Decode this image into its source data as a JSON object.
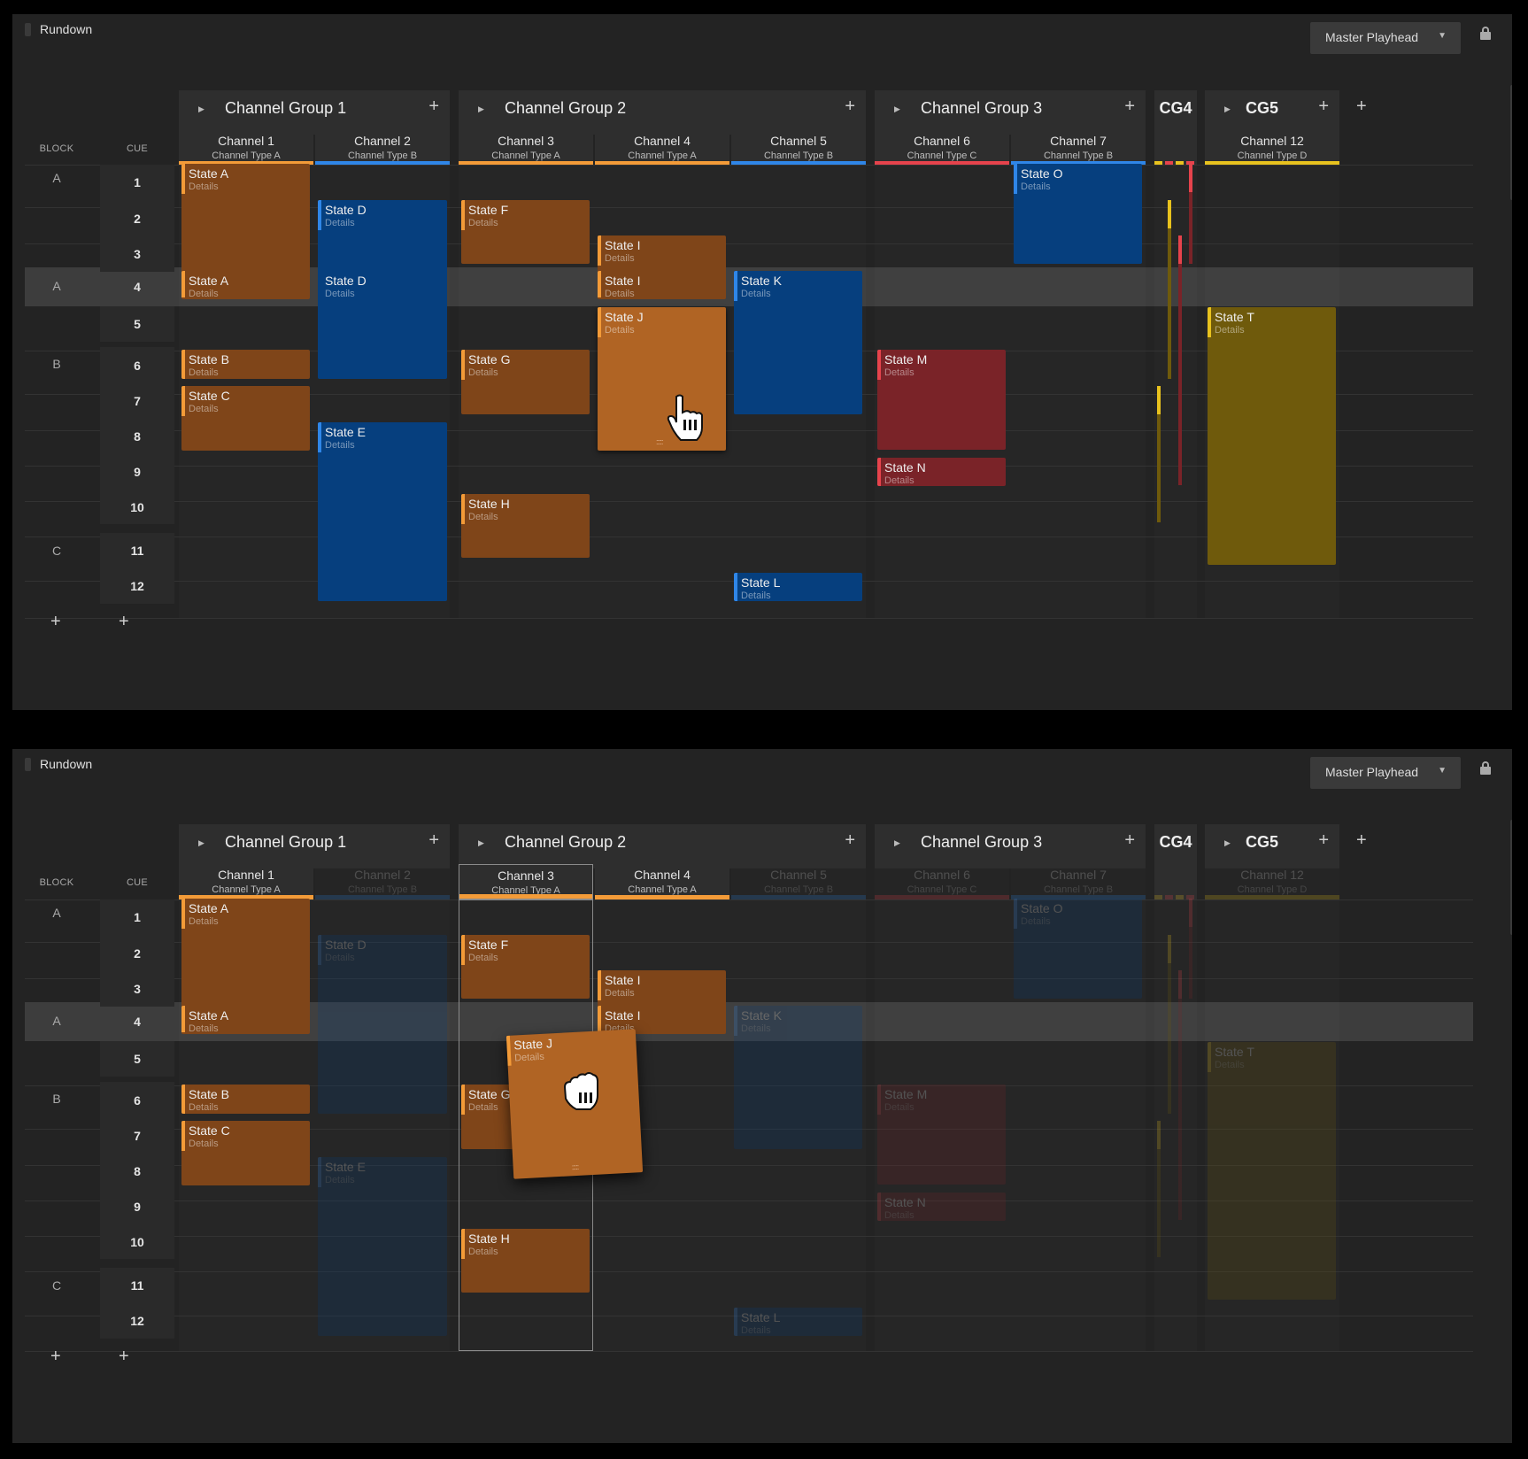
{
  "panels": [
    {
      "title": "Rundown",
      "playhead_label": "Master Playhead",
      "header": {
        "block": "BLOCK",
        "cue": "CUE"
      }
    },
    {
      "title": "Rundown",
      "playhead_label": "Master Playhead",
      "header": {
        "block": "BLOCK",
        "cue": "CUE"
      }
    }
  ],
  "groups": [
    {
      "name": "Channel Group 1"
    },
    {
      "name": "Channel Group 2"
    },
    {
      "name": "Channel Group 3"
    },
    {
      "name": "CG4"
    },
    {
      "name": "CG5"
    }
  ],
  "channels": [
    {
      "name": "Channel 1",
      "type": "Channel Type A",
      "color": "#f39b38"
    },
    {
      "name": "Channel 2",
      "type": "Channel Type B",
      "color": "#2f86e8"
    },
    {
      "name": "Channel 3",
      "type": "Channel Type A",
      "color": "#f39b38"
    },
    {
      "name": "Channel 4",
      "type": "Channel Type A",
      "color": "#f39b38"
    },
    {
      "name": "Channel 5",
      "type": "Channel Type B",
      "color": "#2f86e8"
    },
    {
      "name": "Channel 6",
      "type": "Channel Type C",
      "color": "#e6434c"
    },
    {
      "name": "Channel 7",
      "type": "Channel Type B",
      "color": "#2f86e8"
    },
    {
      "name": "Channel 12",
      "type": "Channel Type D",
      "color": "#e8c21e"
    }
  ],
  "blocks": [
    "A",
    "A",
    "B",
    "C"
  ],
  "cues": [
    "1",
    "2",
    "3",
    "4",
    "5",
    "6",
    "7",
    "8",
    "9",
    "10",
    "11",
    "12"
  ],
  "states": {
    "a": "State A",
    "b": "State B",
    "c": "State C",
    "d": "State D",
    "e": "State E",
    "f": "State F",
    "g": "State G",
    "h": "State H",
    "i": "State I",
    "j": "State J",
    "k": "State K",
    "l": "State L",
    "m": "State M",
    "n": "State N",
    "o": "State O",
    "t": "State T",
    "details": "Details"
  },
  "actions": {
    "add": "+"
  },
  "icons": [
    "chevron-right-icon",
    "plus-icon",
    "caret-down-icon",
    "lock-icon",
    "hand-grab-icon",
    "drag-grip-icon"
  ]
}
